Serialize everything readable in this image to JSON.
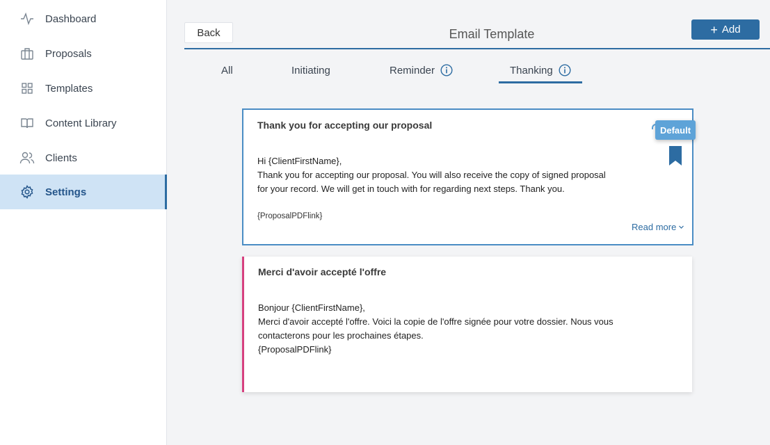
{
  "sidebar": {
    "items": [
      {
        "label": "Dashboard",
        "icon": "activity-icon"
      },
      {
        "label": "Proposals",
        "icon": "briefcase-icon"
      },
      {
        "label": "Templates",
        "icon": "grid-icon"
      },
      {
        "label": "Content Library",
        "icon": "book-icon"
      },
      {
        "label": "Clients",
        "icon": "users-icon"
      },
      {
        "label": "Settings",
        "icon": "gear-icon",
        "active": true
      }
    ]
  },
  "header": {
    "back_label": "Back",
    "title": "Email Template",
    "add_label": "Add"
  },
  "tabs": [
    {
      "label": "All"
    },
    {
      "label": "Initiating"
    },
    {
      "label": "Reminder",
      "has_info": true
    },
    {
      "label": "Thanking",
      "has_info": true,
      "active": true
    }
  ],
  "templates": [
    {
      "title": "Thank you for accepting our proposal",
      "lines": [
        "Hi {ClientFirstName},",
        "Thank you for accepting our proposal. You will also receive the  copy of signed proposal",
        "for your record. We will get in touch with for regarding next steps. Thank you."
      ],
      "footer": "{ProposalPDFlink}",
      "read_more": "Read more",
      "tooltip": "Default",
      "is_default": true
    },
    {
      "title": "Merci d'avoir accepté l'offre",
      "lines": [
        "Bonjour {ClientFirstName},",
        "Merci d'avoir accepté l'offre. Voici la copie de l'offre signée pour votre dossier. Nous vous",
        "contacterons pour les prochaines étapes.",
        "{ProposalPDFlink}"
      ]
    }
  ],
  "colors": {
    "accent": "#2d6ca2",
    "active_bg": "#cfe3f5",
    "card2_border": "#d6407f",
    "tooltip_bg": "#5ea3d8"
  }
}
